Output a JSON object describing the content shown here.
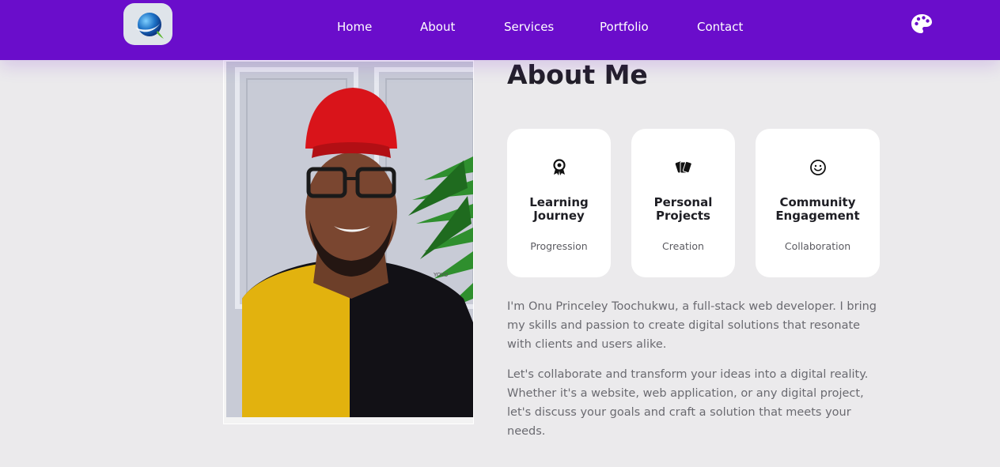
{
  "nav": {
    "links": [
      {
        "label": "Home"
      },
      {
        "label": "About"
      },
      {
        "label": "Services"
      },
      {
        "label": "Portfolio"
      },
      {
        "label": "Contact"
      }
    ],
    "theme_icon": "palette-icon",
    "accent_color": "#6a0dcb"
  },
  "about": {
    "title": "About Me",
    "cards": [
      {
        "icon": "award-icon",
        "title": "Learning\nJourney",
        "subtitle": "Progression"
      },
      {
        "icon": "cards-icon",
        "title": "Personal\nProjects",
        "subtitle": "Creation"
      },
      {
        "icon": "smile-icon",
        "title": "Community\nEngagement",
        "subtitle": "Collaboration"
      }
    ],
    "paragraphs": [
      "I'm Onu Princeley Toochukwu, a full-stack web developer. I bring my skills and passion to create digital solutions that resonate with clients and users alike.",
      "Let's collaborate and transform your ideas into a digital reality. Whether it's a website, web application, or any digital project, let's discuss your goals and craft a solution that meets your needs."
    ]
  }
}
